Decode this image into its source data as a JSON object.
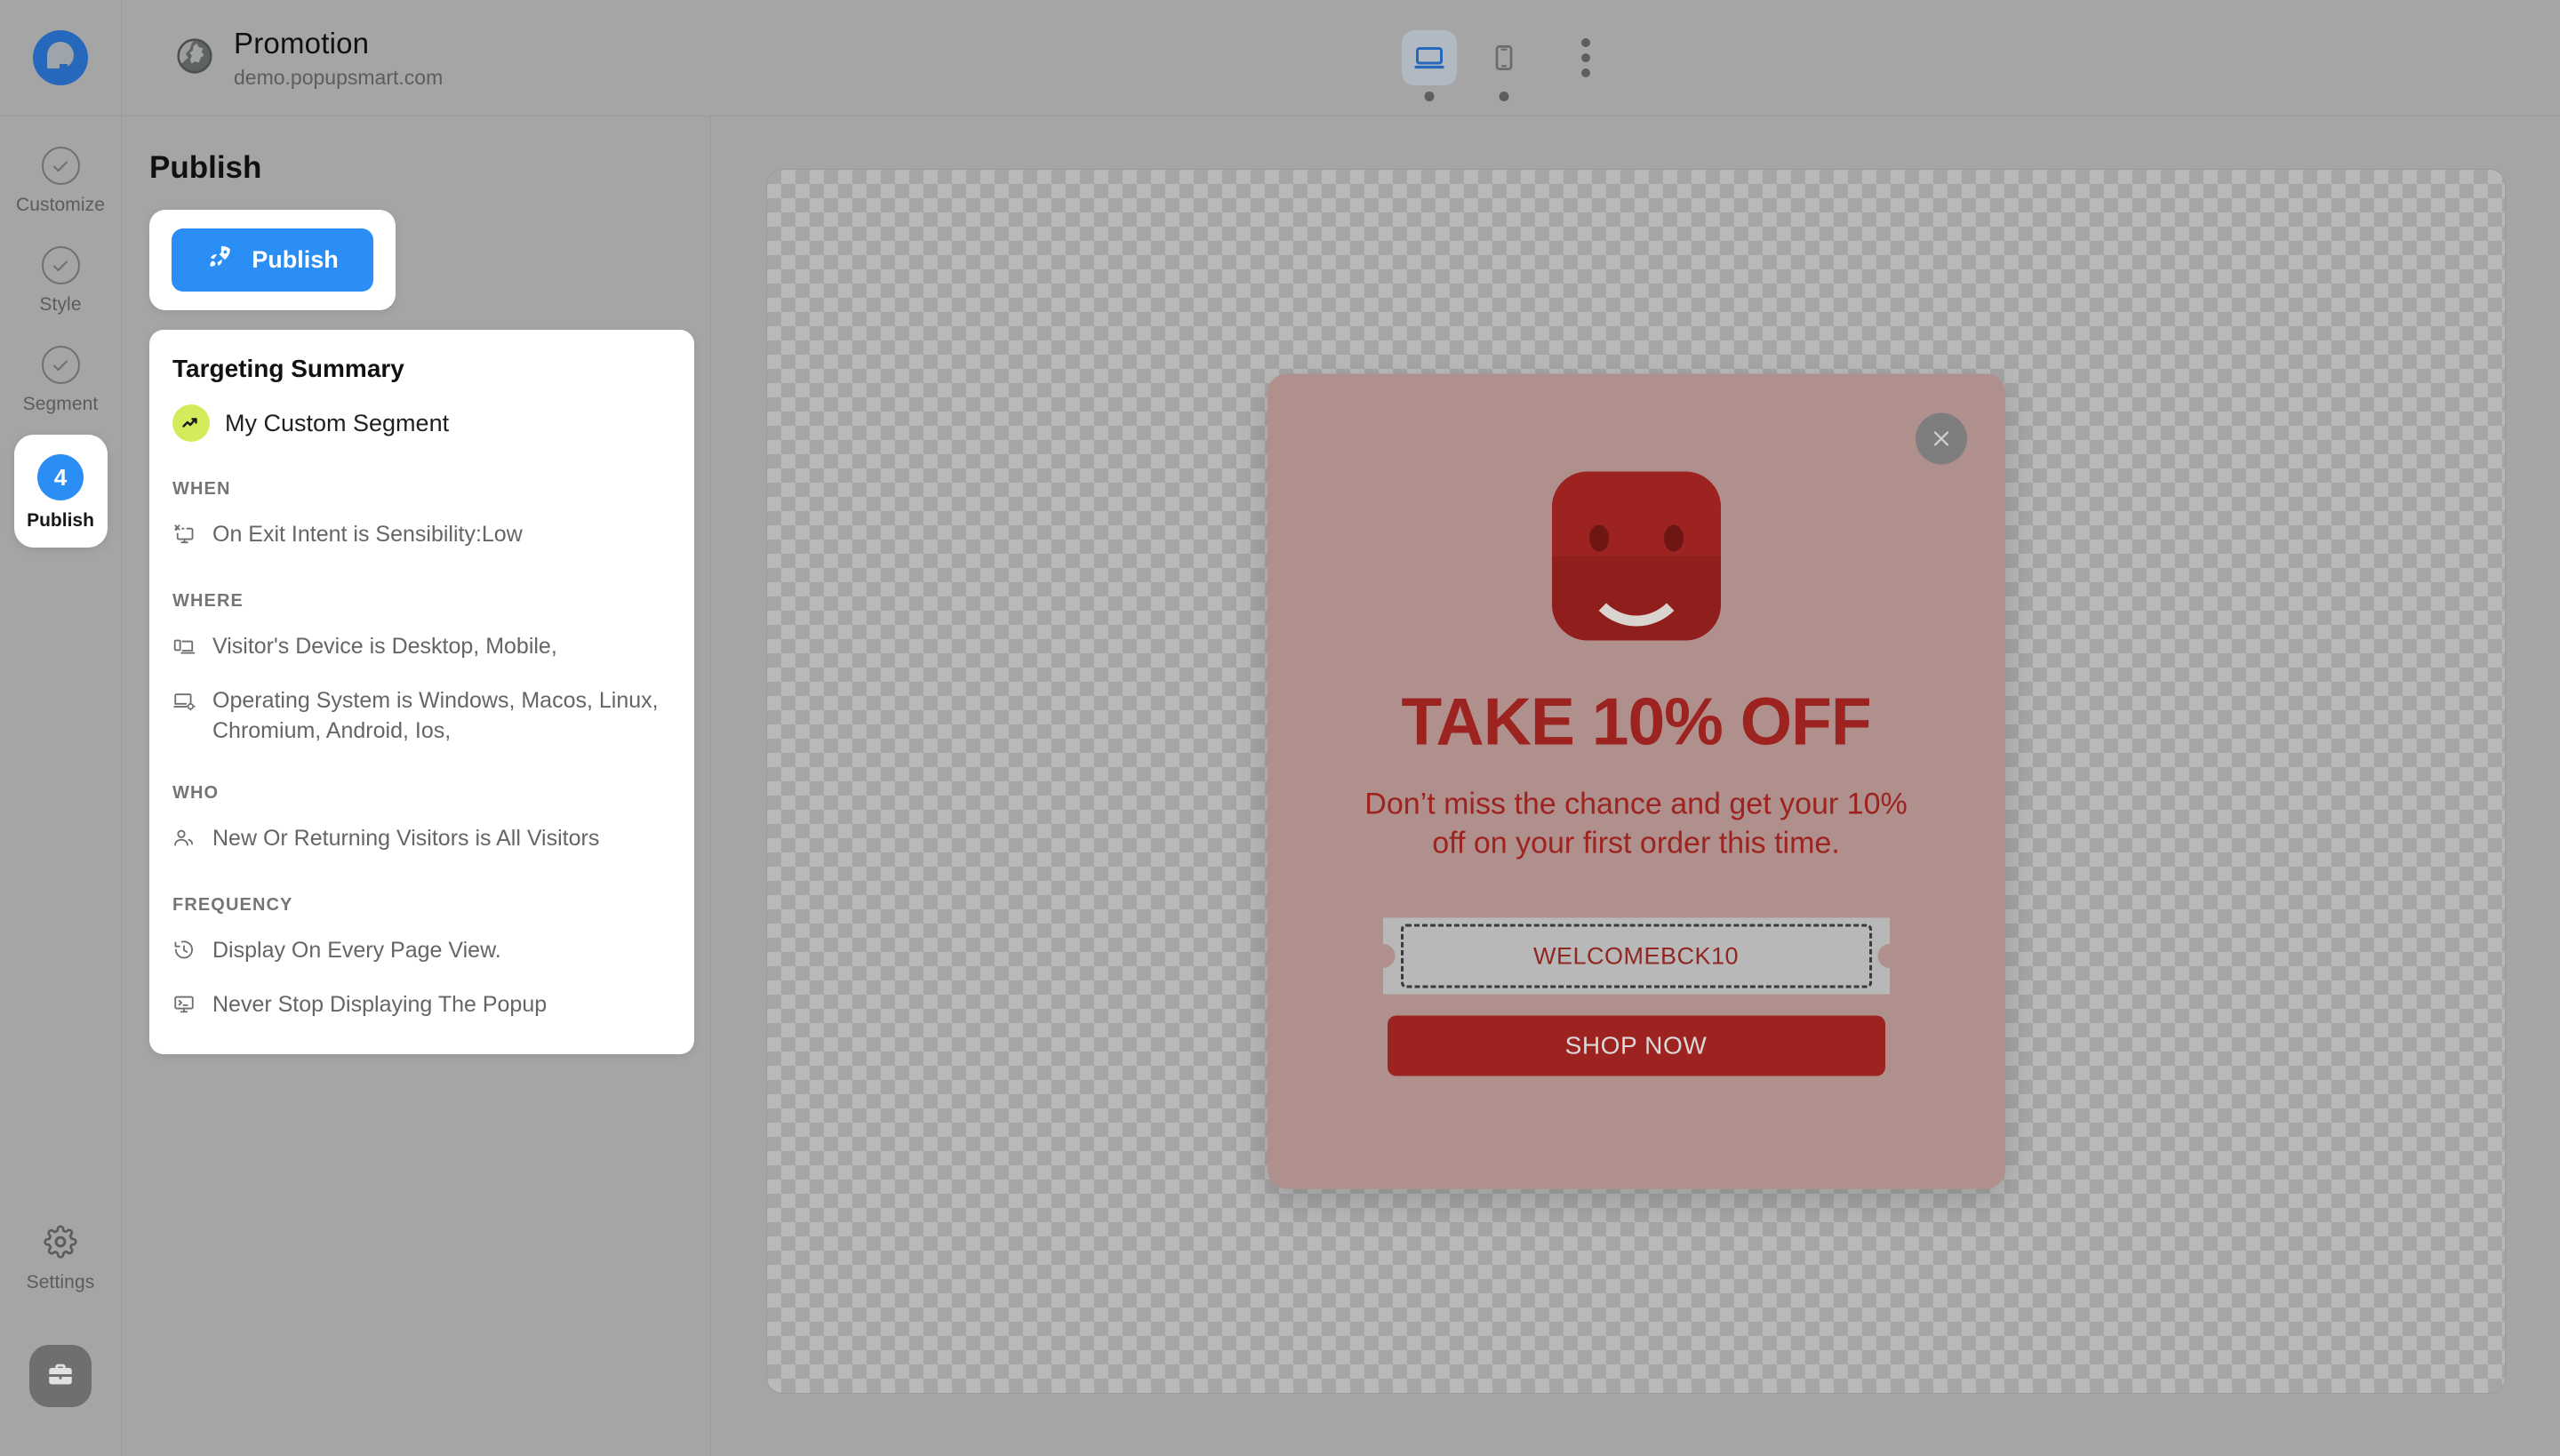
{
  "header": {
    "site_title": "Promotion",
    "site_url": "demo.popupsmart.com",
    "globe_icon": "globe-icon",
    "devices": [
      {
        "name": "desktop",
        "icon": "desktop-icon",
        "active": true
      },
      {
        "name": "mobile",
        "icon": "mobile-icon",
        "active": false
      }
    ],
    "more_icon": "kebab-menu-icon"
  },
  "rail": {
    "logo_icon": "popupsmart-logo",
    "items": [
      {
        "label": "Customize",
        "icon": "check-circle-icon",
        "state": "complete"
      },
      {
        "label": "Style",
        "icon": "check-circle-icon",
        "state": "complete"
      },
      {
        "label": "Segment",
        "icon": "check-circle-icon",
        "state": "complete"
      }
    ],
    "active_item": {
      "label": "Publish",
      "badge": "4"
    },
    "settings": {
      "label": "Settings",
      "icon": "gear-icon"
    },
    "avatar_icon": "briefcase-icon"
  },
  "panel": {
    "title": "Publish",
    "publish_button": {
      "label": "Publish",
      "icon": "rocket-icon"
    },
    "summary": {
      "title": "Targeting Summary",
      "segment_name": "My Custom Segment",
      "segment_icon": "trending-up-icon",
      "sections": [
        {
          "heading": "WHEN",
          "items": [
            {
              "icon": "exit-intent-icon",
              "text": "On Exit Intent is Sensibility:Low"
            }
          ]
        },
        {
          "heading": "WHERE",
          "items": [
            {
              "icon": "devices-icon",
              "text": "Visitor's Device is Desktop, Mobile,"
            },
            {
              "icon": "os-icon",
              "text": "Operating System is Windows, Macos, Linux, Chromium, Android, Ios,"
            }
          ]
        },
        {
          "heading": "WHO",
          "items": [
            {
              "icon": "users-icon",
              "text": "New Or Returning Visitors is All Visitors"
            }
          ]
        },
        {
          "heading": "FREQUENCY",
          "items": [
            {
              "icon": "history-icon",
              "text": "Display On Every Page View."
            },
            {
              "icon": "monitor-code-icon",
              "text": "Never Stop Displaying The Popup"
            }
          ]
        }
      ]
    }
  },
  "popup_preview": {
    "close_icon": "close-icon",
    "bag_icon": "shopping-bag-smile-icon",
    "headline": "TAKE 10% OFF",
    "subtext": "Don’t miss the chance and get your 10% off on your first order this time.",
    "coupon_code": "WELCOMEBCK10",
    "cta_label": "SHOP NOW"
  },
  "colors": {
    "accent_blue": "#2b8ef5",
    "popup_bg": "#b0908d",
    "popup_red": "#9d2320",
    "segment_chip": "#d3ec5b",
    "app_bg": "#a5a5a5"
  }
}
